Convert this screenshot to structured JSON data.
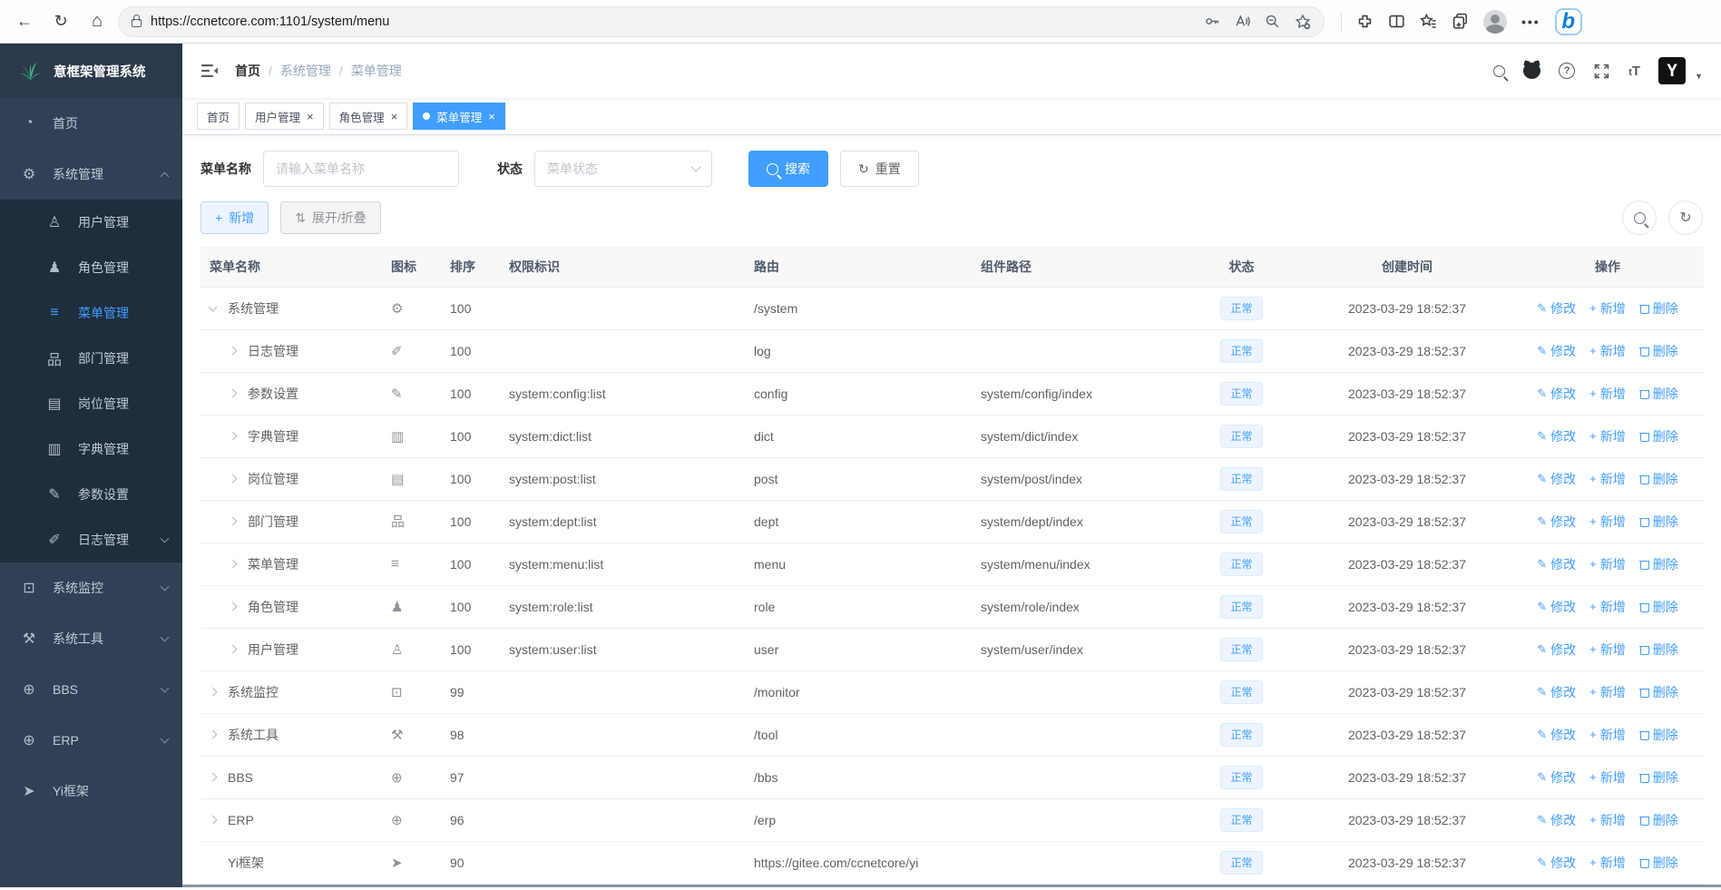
{
  "browser": {
    "url": "https://ccnetcore.com:1101/system/menu",
    "icons_left": [
      "back-icon",
      "refresh-icon",
      "home-icon"
    ],
    "icons_pill": [
      "lock-icon",
      "password-key-icon",
      "read-aloud-icon",
      "zoom-out-icon",
      "favorites-add-icon"
    ],
    "icons_right": [
      "extensions-icon",
      "split-screen-icon",
      "collections-icon",
      "tab-groups-icon",
      "profile-avatar",
      "more-icon",
      "bing-chat-icon"
    ],
    "glyphs": {
      "back": "←",
      "refresh": "↻",
      "home": "⌂",
      "more": "•••",
      "bing": "b"
    }
  },
  "sidebar": {
    "logo_title": "意框架管理系统",
    "items": [
      {
        "label": "首页",
        "icon": "dashboard-icon",
        "glyph": "◔",
        "type": "item"
      },
      {
        "label": "系统管理",
        "icon": "gear-icon",
        "glyph": "⚙",
        "type": "parent-open",
        "children": [
          {
            "label": "用户管理",
            "icon": "user-icon",
            "glyph": "♙"
          },
          {
            "label": "角色管理",
            "icon": "users-icon",
            "glyph": "♟"
          },
          {
            "label": "菜单管理",
            "icon": "menu-list-icon",
            "glyph": "≡",
            "active": true
          },
          {
            "label": "部门管理",
            "icon": "org-tree-icon",
            "glyph": "品"
          },
          {
            "label": "岗位管理",
            "icon": "id-card-icon",
            "glyph": "▤"
          },
          {
            "label": "字典管理",
            "icon": "book-icon",
            "glyph": "▥"
          },
          {
            "label": "参数设置",
            "icon": "edit-icon",
            "glyph": "✎"
          },
          {
            "label": "日志管理",
            "icon": "log-icon",
            "glyph": "✐",
            "chevron": true
          }
        ]
      },
      {
        "label": "系统监控",
        "icon": "monitor-icon",
        "glyph": "⊡",
        "type": "parent",
        "chevron": true
      },
      {
        "label": "系统工具",
        "icon": "toolbox-icon",
        "glyph": "⚒",
        "type": "parent",
        "chevron": true
      },
      {
        "label": "BBS",
        "icon": "globe-icon",
        "glyph": "⊕",
        "type": "parent",
        "chevron": true
      },
      {
        "label": "ERP",
        "icon": "globe-icon",
        "glyph": "⊕",
        "type": "parent",
        "chevron": true
      },
      {
        "label": "Yi框架",
        "icon": "paper-plane-icon",
        "glyph": "➤",
        "type": "item"
      }
    ]
  },
  "navbar": {
    "breadcrumb": [
      "首页",
      "系统管理",
      "菜单管理"
    ],
    "separator": "/",
    "right_icons": [
      "search-icon",
      "github-icon",
      "question-icon",
      "fullscreen-icon",
      "text-size-icon",
      "yi-logo-avatar",
      "caret-down-icon"
    ],
    "text_size_glyph": "tT",
    "question_glyph": "?",
    "logo_glyph": "Y",
    "caret_glyph": "▼"
  },
  "tabs": [
    {
      "label": "首页",
      "closable": false,
      "active": false
    },
    {
      "label": "用户管理",
      "closable": true,
      "active": false
    },
    {
      "label": "角色管理",
      "closable": true,
      "active": false
    },
    {
      "label": "菜单管理",
      "closable": true,
      "active": true
    }
  ],
  "tab_close_glyph": "×",
  "filters": {
    "name_label": "菜单名称",
    "name_placeholder": "请输入菜单名称",
    "status_label": "状态",
    "status_placeholder": "菜单状态",
    "search_label": "搜索",
    "reset_label": "重置",
    "reset_glyph": "↻"
  },
  "toolbar": {
    "add_label": "新增",
    "add_glyph": "+",
    "toggle_label": "展开/折叠",
    "toggle_glyph": "⇅",
    "circle_buttons": [
      "search-circle-button",
      "refresh-circle-button"
    ],
    "refresh_glyph": "↻"
  },
  "table": {
    "headers": [
      "菜单名称",
      "图标",
      "排序",
      "权限标识",
      "路由",
      "组件路径",
      "状态",
      "创建时间",
      "操作"
    ],
    "actions": {
      "edit": "修改",
      "edit_glyph": "✎",
      "add": "新增",
      "add_glyph": "+",
      "del": "删除"
    },
    "rows": [
      {
        "name": "系统管理",
        "level": 0,
        "expand": "open",
        "icon": "gear-icon",
        "glyph": "⚙",
        "order": "100",
        "perms": "",
        "path": "/system",
        "component": "",
        "status": "正常",
        "created": "2023-03-29 18:52:37"
      },
      {
        "name": "日志管理",
        "level": 1,
        "expand": "closed",
        "icon": "log-icon",
        "glyph": "✐",
        "order": "100",
        "perms": "",
        "path": "log",
        "component": "",
        "status": "正常",
        "created": "2023-03-29 18:52:37"
      },
      {
        "name": "参数设置",
        "level": 1,
        "expand": "closed",
        "icon": "edit-icon",
        "glyph": "✎",
        "order": "100",
        "perms": "system:config:list",
        "path": "config",
        "component": "system/config/index",
        "status": "正常",
        "created": "2023-03-29 18:52:37"
      },
      {
        "name": "字典管理",
        "level": 1,
        "expand": "closed",
        "icon": "book-icon",
        "glyph": "▥",
        "order": "100",
        "perms": "system:dict:list",
        "path": "dict",
        "component": "system/dict/index",
        "status": "正常",
        "created": "2023-03-29 18:52:37"
      },
      {
        "name": "岗位管理",
        "level": 1,
        "expand": "closed",
        "icon": "id-card-icon",
        "glyph": "▤",
        "order": "100",
        "perms": "system:post:list",
        "path": "post",
        "component": "system/post/index",
        "status": "正常",
        "created": "2023-03-29 18:52:37"
      },
      {
        "name": "部门管理",
        "level": 1,
        "expand": "closed",
        "icon": "org-tree-icon",
        "glyph": "品",
        "order": "100",
        "perms": "system:dept:list",
        "path": "dept",
        "component": "system/dept/index",
        "status": "正常",
        "created": "2023-03-29 18:52:37"
      },
      {
        "name": "菜单管理",
        "level": 1,
        "expand": "closed",
        "icon": "menu-list-icon",
        "glyph": "≡",
        "order": "100",
        "perms": "system:menu:list",
        "path": "menu",
        "component": "system/menu/index",
        "status": "正常",
        "created": "2023-03-29 18:52:37"
      },
      {
        "name": "角色管理",
        "level": 1,
        "expand": "closed",
        "icon": "users-icon",
        "glyph": "♟",
        "order": "100",
        "perms": "system:role:list",
        "path": "role",
        "component": "system/role/index",
        "status": "正常",
        "created": "2023-03-29 18:52:37"
      },
      {
        "name": "用户管理",
        "level": 1,
        "expand": "closed",
        "icon": "user-icon",
        "glyph": "♙",
        "order": "100",
        "perms": "system:user:list",
        "path": "user",
        "component": "system/user/index",
        "status": "正常",
        "created": "2023-03-29 18:52:37"
      },
      {
        "name": "系统监控",
        "level": 0,
        "expand": "closed",
        "icon": "monitor-icon",
        "glyph": "⊡",
        "order": "99",
        "perms": "",
        "path": "/monitor",
        "component": "",
        "status": "正常",
        "created": "2023-03-29 18:52:37"
      },
      {
        "name": "系统工具",
        "level": 0,
        "expand": "closed",
        "icon": "toolbox-icon",
        "glyph": "⚒",
        "order": "98",
        "perms": "",
        "path": "/tool",
        "component": "",
        "status": "正常",
        "created": "2023-03-29 18:52:37"
      },
      {
        "name": "BBS",
        "level": 0,
        "expand": "closed",
        "icon": "globe-icon",
        "glyph": "⊕",
        "order": "97",
        "perms": "",
        "path": "/bbs",
        "component": "",
        "status": "正常",
        "created": "2023-03-29 18:52:37"
      },
      {
        "name": "ERP",
        "level": 0,
        "expand": "closed",
        "icon": "globe-icon",
        "glyph": "⊕",
        "order": "96",
        "perms": "",
        "path": "/erp",
        "component": "",
        "status": "正常",
        "created": "2023-03-29 18:52:37"
      },
      {
        "name": "Yi框架",
        "level": 0,
        "expand": "none",
        "icon": "paper-plane-icon",
        "glyph": "➤",
        "order": "90",
        "perms": "",
        "path": "https://gitee.com/ccnetcore/yi",
        "component": "",
        "status": "正常",
        "created": "2023-03-29 18:52:37"
      }
    ]
  },
  "colors": {
    "primary": "#409eff",
    "sidebar_bg": "#304156",
    "sidebar_submenu_bg": "#1f2d3d",
    "sidebar_text": "#bfcbd9",
    "badge_bg": "#ecf5ff",
    "badge_border": "#d9ecff",
    "table_header_bg": "#f8f8f9",
    "row_border": "#ebeef5",
    "logo_green": "#3eb185"
  }
}
